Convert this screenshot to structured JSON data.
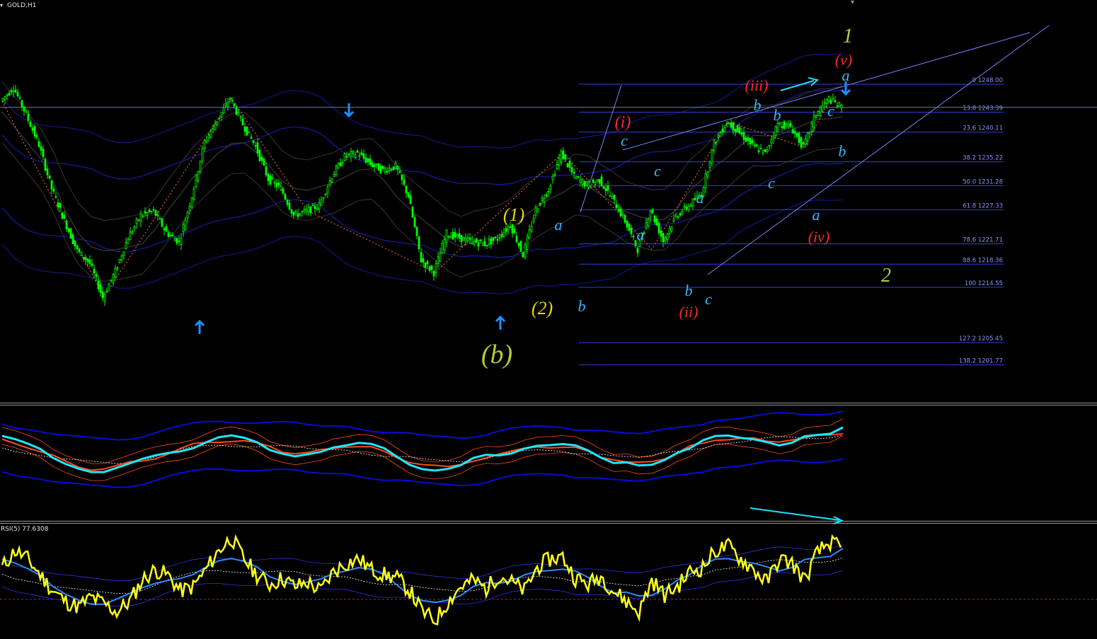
{
  "window": {
    "symbol_label": "GOLD,H1",
    "rsi_label": "RSI(5) 77.6308"
  },
  "colors": {
    "background": "#000000",
    "candle": "#00ff00",
    "fib_line": "#3b3bdc",
    "fib_text": "#8d8dff",
    "bollinger_outer": "#141480",
    "bollinger_mid": "#3a3a3a",
    "zigzag": "#ff7a2a",
    "trend_line": "#7f7fff",
    "arrow": "#1e90ff",
    "label_green": "#b6c93a",
    "label_yellow": "#e8d800",
    "label_cyan": "#33b8ff",
    "label_red": "#ff2a2a",
    "osc_cyan": "#1fe6ff",
    "osc_red": "#ff4a1a",
    "osc_blue": "#0a0ad8",
    "rsi_yellow": "#ffff1a",
    "rsi_blue": "#2a8cff",
    "divergence_arrow": "#1fe0ff"
  },
  "chart_data": {
    "type": "candlestick",
    "symbol": "GOLD",
    "timeframe": "H1",
    "price_series": [
      1245.2,
      1247.5,
      1243.0,
      1238.0,
      1230.8,
      1225.5,
      1220.6,
      1218.5,
      1212.9,
      1217.2,
      1222.8,
      1226.4,
      1227.1,
      1223.6,
      1222.0,
      1229.6,
      1238.5,
      1242.1,
      1245.7,
      1241.4,
      1237.8,
      1232.4,
      1230.8,
      1226.4,
      1227.1,
      1228.1,
      1232.9,
      1236.1,
      1236.7,
      1234.9,
      1233.8,
      1234.5,
      1229.6,
      1219.0,
      1217.0,
      1223.4,
      1222.7,
      1222.1,
      1221.7,
      1222.6,
      1224.9,
      1219.9,
      1227.4,
      1230.7,
      1236.7,
      1232.8,
      1231.4,
      1232.2,
      1229.2,
      1225.5,
      1220.8,
      1227.4,
      1222.2,
      1226.3,
      1228.0,
      1230.0,
      1238.3,
      1241.8,
      1240.0,
      1237.9,
      1236.6,
      1241.5,
      1241.0,
      1237.6,
      1243.2,
      1245.6,
      1244.2
    ],
    "fib_levels": [
      {
        "level": "0",
        "price": "1248.00"
      },
      {
        "level": "13.8",
        "price": "1243.39"
      },
      {
        "level": "23.6",
        "price": "1240.11"
      },
      {
        "level": "38.2",
        "price": "1235.22"
      },
      {
        "level": "50.0",
        "price": "1231.28"
      },
      {
        "level": "61.8",
        "price": "1227.33"
      },
      {
        "level": "78.6",
        "price": "1221.71"
      },
      {
        "level": "88.6",
        "price": "1218.36"
      },
      {
        "level": "100",
        "price": "1214.55"
      },
      {
        "level": "127.2",
        "price": "1205.45"
      },
      {
        "level": "138.2",
        "price": "1201.77"
      }
    ],
    "wave_labels": [
      {
        "text": "1",
        "color": "label_green"
      },
      {
        "text": "2",
        "color": "label_green"
      },
      {
        "text": "(b)",
        "color": "label_green"
      },
      {
        "text": "(1)",
        "color": "label_yellow"
      },
      {
        "text": "(2)",
        "color": "label_yellow"
      },
      {
        "text": "(i)",
        "color": "label_red"
      },
      {
        "text": "(ii)",
        "color": "label_red"
      },
      {
        "text": "(iii)",
        "color": "label_red"
      },
      {
        "text": "(iv)",
        "color": "label_red"
      },
      {
        "text": "(v)",
        "color": "label_red"
      },
      {
        "text": "a",
        "color": "label_cyan"
      },
      {
        "text": "b",
        "color": "label_cyan"
      },
      {
        "text": "c",
        "color": "label_cyan"
      },
      {
        "text": "a",
        "color": "label_cyan"
      },
      {
        "text": "c",
        "color": "label_cyan"
      },
      {
        "text": "b",
        "color": "label_cyan"
      },
      {
        "text": "a",
        "color": "label_cyan"
      },
      {
        "text": "c",
        "color": "label_cyan"
      },
      {
        "text": "b",
        "color": "label_cyan"
      },
      {
        "text": "c",
        "color": "label_cyan"
      },
      {
        "text": "b",
        "color": "label_cyan"
      },
      {
        "text": "a",
        "color": "label_cyan"
      },
      {
        "text": "b",
        "color": "label_cyan"
      },
      {
        "text": "c",
        "color": "label_cyan"
      },
      {
        "text": "a",
        "color": "label_cyan"
      },
      {
        "text": "b",
        "color": "label_cyan"
      },
      {
        "text": "c",
        "color": "label_cyan"
      }
    ],
    "arrows": [
      {
        "direction": "up"
      },
      {
        "direction": "down"
      },
      {
        "direction": "up"
      },
      {
        "direction": "down"
      }
    ],
    "rsi": {
      "period": 5,
      "value": 77.6308,
      "series": [
        62,
        78,
        70,
        55,
        40,
        30,
        25,
        34,
        28,
        20,
        30,
        50,
        60,
        55,
        40,
        44,
        60,
        78,
        90,
        70,
        55,
        46,
        52,
        44,
        48,
        40,
        58,
        66,
        70,
        60,
        55,
        52,
        40,
        20,
        12,
        30,
        44,
        50,
        42,
        55,
        48,
        40,
        62,
        70,
        72,
        52,
        46,
        54,
        40,
        30,
        20,
        50,
        36,
        44,
        58,
        62,
        78,
        82,
        70,
        60,
        48,
        70,
        66,
        50,
        76,
        86,
        78
      ]
    }
  }
}
